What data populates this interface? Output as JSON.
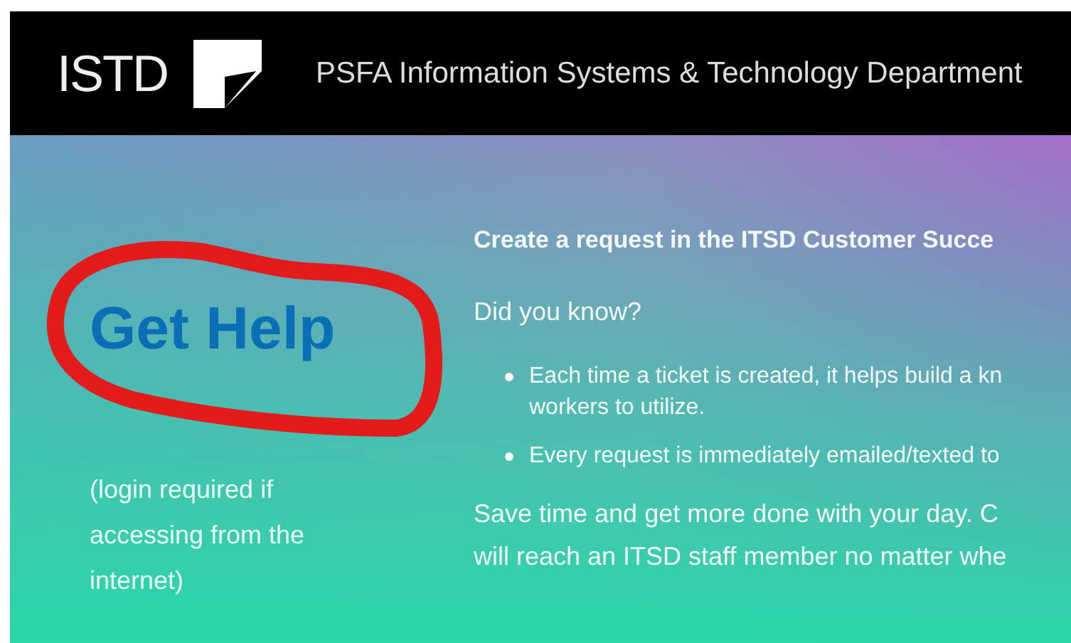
{
  "header": {
    "abbreviation": "ISTD",
    "title": "PSFA Information Systems & Technology Department"
  },
  "left": {
    "link": "Get Help",
    "note_lines": [
      "(login required if",
      "accessing from the",
      "internet)"
    ]
  },
  "main": {
    "heading": "Create a request in the ITSD Customer Succe",
    "subheading": "Did you know?",
    "bullets": [
      {
        "lines": [
          "Each time a ticket is created, it helps build a kn",
          "workers to utilize."
        ]
      },
      {
        "lines": [
          "Every request is immediately emailed/texted to"
        ]
      }
    ],
    "closing_lines": [
      "Save time and get more done with your day. C",
      "will reach an ITSD staff member no matter whe"
    ]
  }
}
